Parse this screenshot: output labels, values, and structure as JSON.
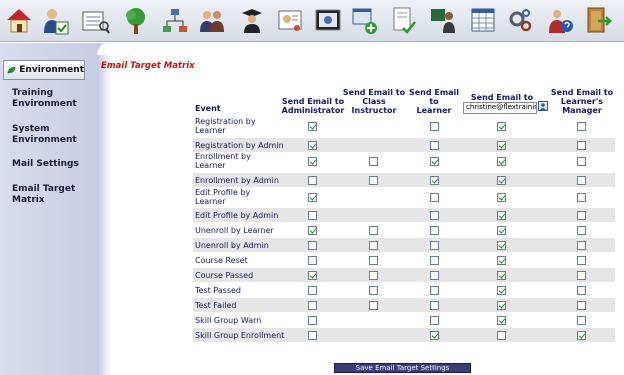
{
  "toolbar": {
    "icons": [
      "home-icon",
      "user-check-icon",
      "courses-icon",
      "tree-icon",
      "org-chart-icon",
      "group-icon",
      "graduate-icon",
      "certificate-icon",
      "media-icon",
      "add-window-icon",
      "document-check-icon",
      "instructor-icon",
      "table-icon",
      "settings-icon",
      "help-user-icon",
      "exit-door-icon"
    ]
  },
  "sidebar": {
    "active_label": "Environment",
    "items": [
      {
        "label": "Training Environment",
        "line1": "Training",
        "line2": "Environment"
      },
      {
        "label": "System Environment",
        "line1": "System",
        "line2": "Environment"
      },
      {
        "label": "Mail Settings",
        "line1": "Mail Settings",
        "line2": ""
      },
      {
        "label": "Email Target Matrix",
        "line1": "Email Target",
        "line2": "Matrix"
      }
    ]
  },
  "page_title": "Email Target Matrix",
  "table": {
    "event_header": "Event",
    "columns": [
      {
        "l1": "Send Email to",
        "l2": "Administrator",
        "l3": ""
      },
      {
        "l1": "Send Email to",
        "l2": "Class",
        "l3": "Instructor"
      },
      {
        "l1": "Send Email",
        "l2": "to",
        "l3": "Learner"
      },
      {
        "l1": "Send Email to",
        "l2": "",
        "l3": ""
      },
      {
        "l1": "Send Email to",
        "l2": "Learner's",
        "l3": "Manager"
      }
    ],
    "email_value": "christine@flextrainin",
    "rows": [
      {
        "event": "Registration by Learner",
        "l1": "Registration by",
        "l2": "Learner",
        "checks": [
          true,
          null,
          false,
          true,
          false
        ]
      },
      {
        "event": "Registration by Admin",
        "l1": "Registration by Admin",
        "l2": "",
        "checks": [
          true,
          null,
          false,
          true,
          false
        ]
      },
      {
        "event": "Enrollment by Learner",
        "l1": "Enrollment by",
        "l2": "Learner",
        "checks": [
          true,
          false,
          true,
          true,
          false
        ]
      },
      {
        "event": "Enrollment by Admin",
        "l1": "Enrollment by Admin",
        "l2": "",
        "checks": [
          false,
          false,
          true,
          true,
          false
        ]
      },
      {
        "event": "Edit Profile by Learner",
        "l1": "Edit Profile by",
        "l2": "Learner",
        "checks": [
          true,
          null,
          false,
          true,
          false
        ]
      },
      {
        "event": "Edit Profile by Admin",
        "l1": "Edit Profile by Admin",
        "l2": "",
        "checks": [
          false,
          null,
          false,
          true,
          false
        ]
      },
      {
        "event": "Unenroll by Learner",
        "l1": "Unenroll by Learner",
        "l2": "",
        "checks": [
          true,
          false,
          false,
          true,
          false
        ]
      },
      {
        "event": "Unenroll by Admin",
        "l1": "Unenroll by Admin",
        "l2": "",
        "checks": [
          false,
          false,
          false,
          true,
          false
        ]
      },
      {
        "event": "Course Reset",
        "l1": "Course Reset",
        "l2": "",
        "checks": [
          false,
          false,
          false,
          true,
          false
        ]
      },
      {
        "event": "Course Passed",
        "l1": "Course Passed",
        "l2": "",
        "checks": [
          true,
          false,
          false,
          true,
          false
        ]
      },
      {
        "event": "Test Passed",
        "l1": "Test Passed",
        "l2": "",
        "checks": [
          false,
          false,
          false,
          true,
          false
        ]
      },
      {
        "event": "Test Failed",
        "l1": "Test Failed",
        "l2": "",
        "checks": [
          false,
          false,
          false,
          true,
          false
        ]
      },
      {
        "event": "Skill Group Warn",
        "l1": "Skill Group Warn",
        "l2": "",
        "checks": [
          false,
          null,
          false,
          true,
          false
        ]
      },
      {
        "event": "Skill Group Enrollment",
        "l1": "Skill Group Enrollment",
        "l2": "",
        "checks": [
          false,
          null,
          true,
          false,
          true
        ]
      }
    ]
  },
  "save_label": "Save Email Target Settings"
}
